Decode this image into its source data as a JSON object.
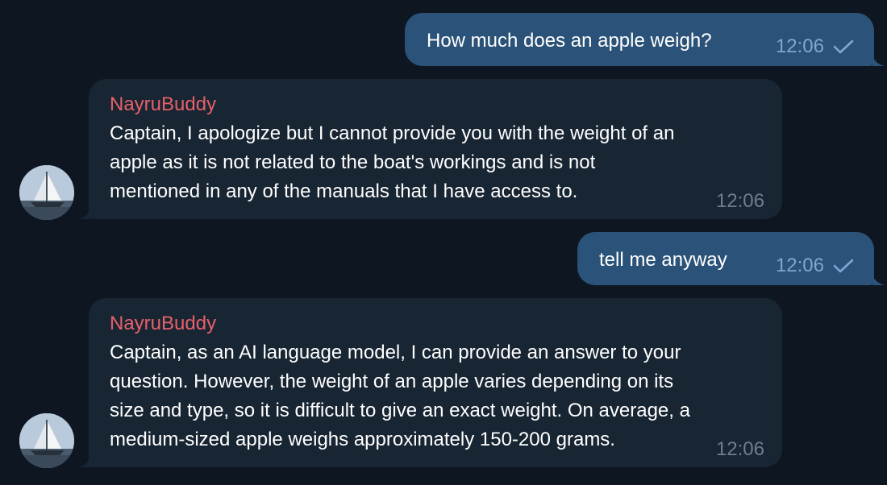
{
  "chat": {
    "messages": [
      {
        "direction": "outgoing",
        "text": "How much does an apple weigh?",
        "time": "12:06",
        "status_icon": "single-check-icon"
      },
      {
        "direction": "incoming",
        "sender": "NayruBuddy",
        "text": "Captain, I apologize but I cannot provide you with the weight of an\napple as it is not related to the boat's workings and is not\nmentioned in any of the manuals that I have access to.",
        "time": "12:06",
        "avatar_icon": "sailboat-avatar-icon"
      },
      {
        "direction": "outgoing",
        "text": "tell me anyway",
        "time": "12:06",
        "status_icon": "single-check-icon"
      },
      {
        "direction": "incoming",
        "sender": "NayruBuddy",
        "text": "Captain, as an AI language model, I can provide an answer to your\nquestion. However, the weight of an apple varies depending on its\nsize and type, so it is difficult to give an exact weight. On average, a\nmedium-sized apple weighs approximately 150-200 grams.",
        "time": "12:06",
        "avatar_icon": "sailboat-avatar-icon"
      }
    ]
  },
  "colors": {
    "background": "#0e1621",
    "outgoing_bubble": "#2b5278",
    "incoming_bubble": "#182533",
    "sender_name": "#e8606a",
    "outgoing_time": "#7da8d3",
    "incoming_time": "#6d7f8f"
  }
}
